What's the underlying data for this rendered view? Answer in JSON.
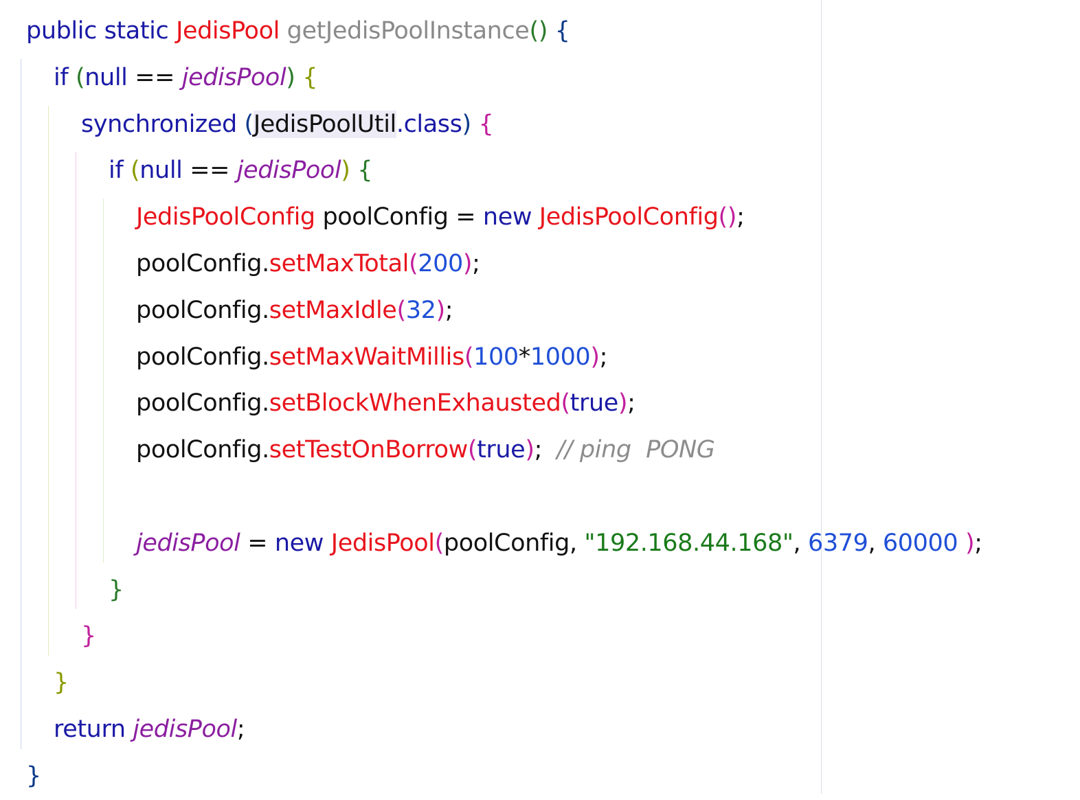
{
  "code": {
    "lines": [
      [
        {
          "t": "public static ",
          "c": "kw"
        },
        {
          "t": "JedisPool",
          "c": "type"
        },
        {
          "t": " ",
          "c": "op"
        },
        {
          "t": "getJedisPoolInstance",
          "c": "fn"
        },
        {
          "t": "()",
          "c": "p1"
        },
        {
          "t": " {",
          "c": "p3"
        }
      ],
      [
        {
          "t": "if ",
          "c": "kw"
        },
        {
          "t": "(",
          "c": "p1"
        },
        {
          "t": "null ",
          "c": "kw"
        },
        {
          "t": "== ",
          "c": "op"
        },
        {
          "t": "jedisPool",
          "c": "field"
        },
        {
          "t": ")",
          "c": "p1"
        },
        {
          "t": " {",
          "c": "p2"
        }
      ],
      [
        {
          "t": "synchronized ",
          "c": "kw"
        },
        {
          "t": "(",
          "c": "p3"
        },
        {
          "t": "JedisPoolUtil",
          "c": "id",
          "sel": true
        },
        {
          "t": ".class",
          "c": "kw"
        },
        {
          "t": ")",
          "c": "p3"
        },
        {
          "t": " {",
          "c": "p4"
        }
      ],
      [
        {
          "t": "if ",
          "c": "kw"
        },
        {
          "t": "(",
          "c": "p2"
        },
        {
          "t": "null ",
          "c": "kw"
        },
        {
          "t": "== ",
          "c": "op"
        },
        {
          "t": "jedisPool",
          "c": "field"
        },
        {
          "t": ")",
          "c": "p2"
        },
        {
          "t": " {",
          "c": "p1"
        }
      ],
      [
        {
          "t": "JedisPoolConfig",
          "c": "type"
        },
        {
          "t": " poolConfig = ",
          "c": "id"
        },
        {
          "t": "new ",
          "c": "kw"
        },
        {
          "t": "JedisPoolConfig",
          "c": "type"
        },
        {
          "t": "()",
          "c": "p4"
        },
        {
          "t": ";",
          "c": "op"
        }
      ],
      [
        {
          "t": "poolConfig.",
          "c": "id"
        },
        {
          "t": "setMaxTotal",
          "c": "call"
        },
        {
          "t": "(",
          "c": "p4"
        },
        {
          "t": "200",
          "c": "num"
        },
        {
          "t": ")",
          "c": "p4"
        },
        {
          "t": ";",
          "c": "op"
        }
      ],
      [
        {
          "t": "poolConfig.",
          "c": "id"
        },
        {
          "t": "setMaxIdle",
          "c": "call"
        },
        {
          "t": "(",
          "c": "p4"
        },
        {
          "t": "32",
          "c": "num"
        },
        {
          "t": ")",
          "c": "p4"
        },
        {
          "t": ";",
          "c": "op"
        }
      ],
      [
        {
          "t": "poolConfig.",
          "c": "id"
        },
        {
          "t": "setMaxWaitMillis",
          "c": "call"
        },
        {
          "t": "(",
          "c": "p4"
        },
        {
          "t": "100",
          "c": "num"
        },
        {
          "t": "*",
          "c": "op"
        },
        {
          "t": "1000",
          "c": "num"
        },
        {
          "t": ")",
          "c": "p4"
        },
        {
          "t": ";",
          "c": "op"
        }
      ],
      [
        {
          "t": "poolConfig.",
          "c": "id"
        },
        {
          "t": "setBlockWhenExhausted",
          "c": "call"
        },
        {
          "t": "(",
          "c": "p4"
        },
        {
          "t": "true",
          "c": "kw"
        },
        {
          "t": ")",
          "c": "p4"
        },
        {
          "t": ";",
          "c": "op"
        }
      ],
      [
        {
          "t": "poolConfig.",
          "c": "id"
        },
        {
          "t": "setTestOnBorrow",
          "c": "call"
        },
        {
          "t": "(",
          "c": "p4"
        },
        {
          "t": "true",
          "c": "kw"
        },
        {
          "t": ")",
          "c": "p4"
        },
        {
          "t": ";  ",
          "c": "op"
        },
        {
          "t": "// ping  PONG",
          "c": "cmt"
        }
      ],
      [],
      [
        {
          "t": "jedisPool",
          "c": "field"
        },
        {
          "t": " = ",
          "c": "op"
        },
        {
          "t": "new ",
          "c": "kw"
        },
        {
          "t": "JedisPool",
          "c": "type"
        },
        {
          "t": "(",
          "c": "p4"
        },
        {
          "t": "poolConfig, ",
          "c": "id"
        },
        {
          "t": "\"192.168.44.168\"",
          "c": "str"
        },
        {
          "t": ", ",
          "c": "op"
        },
        {
          "t": "6379",
          "c": "num"
        },
        {
          "t": ", ",
          "c": "op"
        },
        {
          "t": "60000 ",
          "c": "num"
        },
        {
          "t": ")",
          "c": "p4"
        },
        {
          "t": ";",
          "c": "op"
        }
      ],
      [
        {
          "t": "}",
          "c": "p1"
        }
      ],
      [
        {
          "t": "}",
          "c": "p4"
        }
      ],
      [
        {
          "t": "}",
          "c": "p2"
        }
      ],
      [
        {
          "t": "return ",
          "c": "kw"
        },
        {
          "t": "jedisPool",
          "c": "field"
        },
        {
          "t": ";",
          "c": "op"
        }
      ],
      [
        {
          "t": "}",
          "c": "p3"
        }
      ]
    ],
    "indents": [
      0,
      1,
      2,
      3,
      4,
      4,
      4,
      4,
      4,
      4,
      4,
      4,
      3,
      2,
      1,
      1,
      0
    ],
    "guide_colors": [
      "#c8d3ea",
      "#e9ecb8",
      "#f3c8e6",
      "#e0ecd0"
    ]
  }
}
